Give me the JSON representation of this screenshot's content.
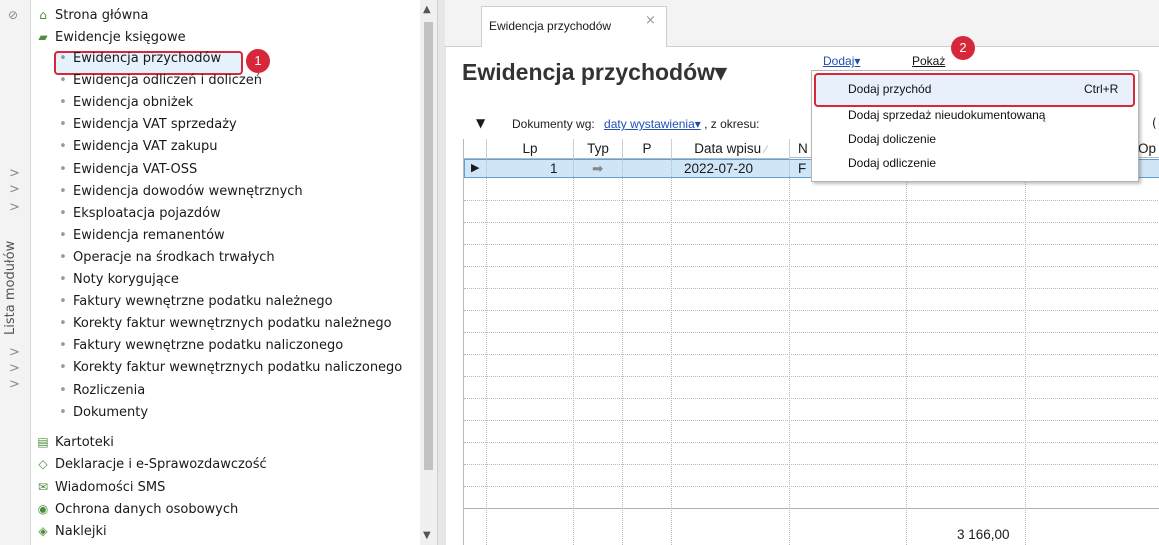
{
  "modules_strip": {
    "label": "Lista modułów",
    "chevrons": [
      ">",
      ">",
      ">",
      ">",
      ">",
      ">",
      ">"
    ]
  },
  "tree": {
    "top_items": [
      {
        "label": "Strona główna",
        "icon": "home-icon"
      },
      {
        "label": "Ewidencje księgowe",
        "icon": "books-icon"
      }
    ],
    "sub_items": [
      "Ewidencja przychodów",
      "Ewidencja odliczeń i doliczeń",
      "Ewidencja obniżek",
      "Ewidencja VAT sprzedaży",
      "Ewidencja VAT zakupu",
      "Ewidencja VAT-OSS",
      "Ewidencja dowodów wewnętrznych",
      "Eksploatacja pojazdów",
      "Ewidencja remanentów",
      "Operacje na środkach trwałych",
      "Noty korygujące",
      "Faktury wewnętrzne podatku należnego",
      "Korekty faktur wewnętrznych podatku należnego",
      "Faktury wewnętrzne podatku naliczonego",
      "Korekty faktur wewnętrznych podatku naliczonego",
      "Rozliczenia",
      "Dokumenty"
    ],
    "bottom_items": [
      {
        "label": "Kartoteki",
        "icon": "cards-icon"
      },
      {
        "label": "Deklaracje i e-Sprawozdawczość",
        "icon": "declaration-icon"
      },
      {
        "label": "Wiadomości SMS",
        "icon": "sms-icon"
      },
      {
        "label": "Ochrona danych osobowych",
        "icon": "shield-icon"
      },
      {
        "label": "Naklejki",
        "icon": "sticker-icon"
      }
    ],
    "selected": "Ewidencja przychodów"
  },
  "badges": {
    "b1": "1",
    "b2": "2"
  },
  "tab": {
    "label": "Ewidencja przychodów",
    "close": "×"
  },
  "page": {
    "title": "Ewidencja przychodów▾",
    "dodaj": "Dodaj▾",
    "pokaz": "Pokaż"
  },
  "filter": {
    "prefix": "Dokumenty wg:",
    "date_link": "daty wystawienia▾",
    "suffix": ", z okresu:",
    "right": "("
  },
  "grid": {
    "headers": [
      "Lp",
      "Typ",
      "P",
      "Data wpisu",
      "N",
      "",
      "Op"
    ],
    "row": {
      "lp": "1",
      "typ": "➡",
      "date": "2022-07-20",
      "n": "F"
    },
    "total": "3 166,00"
  },
  "menu": {
    "items": [
      {
        "label": "Dodaj przychód",
        "shortcut": "Ctrl+R"
      },
      {
        "label": "Dodaj sprzedaż nieudokumentowaną",
        "shortcut": ""
      },
      {
        "label": "Dodaj doliczenie",
        "shortcut": ""
      },
      {
        "label": "Dodaj odliczenie",
        "shortcut": ""
      }
    ]
  },
  "colors": {
    "accent_red": "#d6283a",
    "selection_blue": "#cfe6f8",
    "link_blue": "#1f4fb5"
  }
}
